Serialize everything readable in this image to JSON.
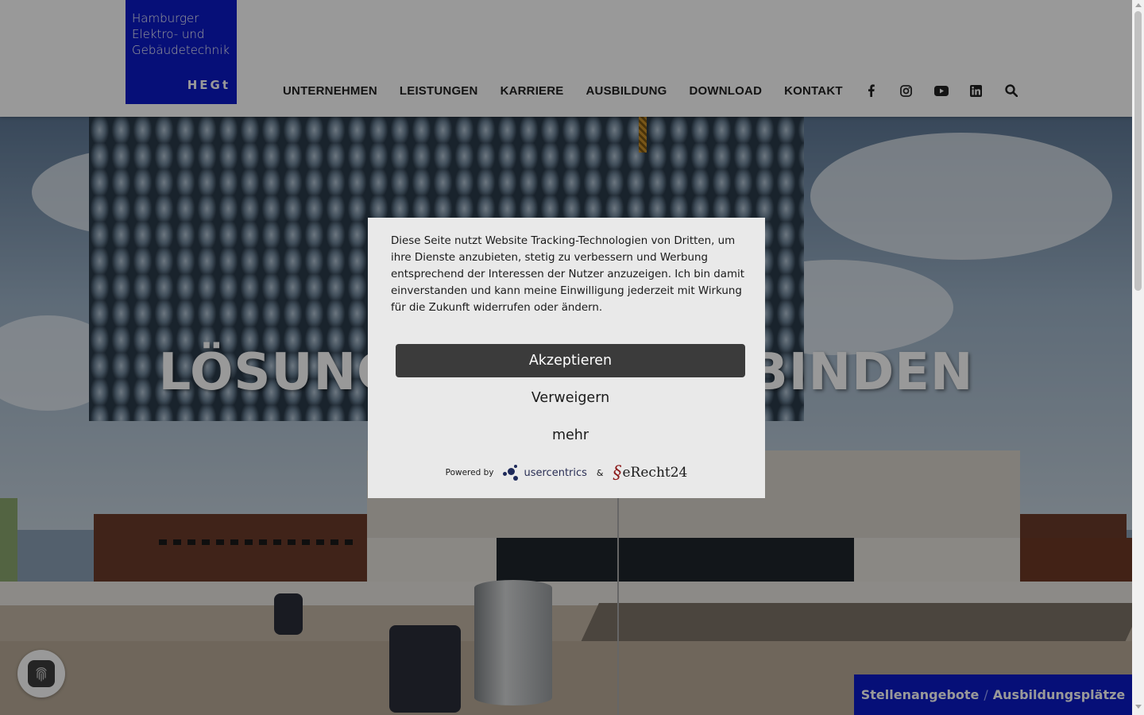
{
  "logo": {
    "line1": "Hamburger",
    "line2": "Elektro- und",
    "line3": "Gebäudetechnik",
    "short": "HEGt",
    "color": "#0a19c8"
  },
  "nav": {
    "items": [
      "UNTERNEHMEN",
      "LEISTUNGEN",
      "KARRIERE",
      "AUSBILDUNG",
      "DOWNLOAD",
      "KONTAKT"
    ],
    "icons": [
      "facebook-icon",
      "instagram-icon",
      "youtube-icon",
      "linkedin-icon",
      "search-icon"
    ]
  },
  "hero": {
    "title": "LÖSUNGEN, DIE VERBINDEN"
  },
  "consent": {
    "text": "Diese Seite nutzt Website Tracking-Technologien von Dritten, um ihre Dienste anzubieten, stetig zu verbessern und Werbung entsprechend der Interessen der Nutzer anzuzeigen. Ich bin damit einverstanden und kann meine Einwilligung jederzeit mit Wirkung für die Zukunft widerrufen oder ändern.",
    "accept_label": "Akzeptieren",
    "deny_label": "Verweigern",
    "more_label": "mehr",
    "powered_by": "Powered by",
    "brand1": "usercentrics",
    "amp": "&",
    "brand2": "eRecht24"
  },
  "job_button": {
    "part1": "Stellenangebote",
    "sep": "/",
    "part2": "Ausbildungsplätze"
  },
  "colors": {
    "brand_blue": "#0a19c8",
    "accept_button": "#3b3b3b",
    "consent_bg": "#e9e9e9"
  }
}
